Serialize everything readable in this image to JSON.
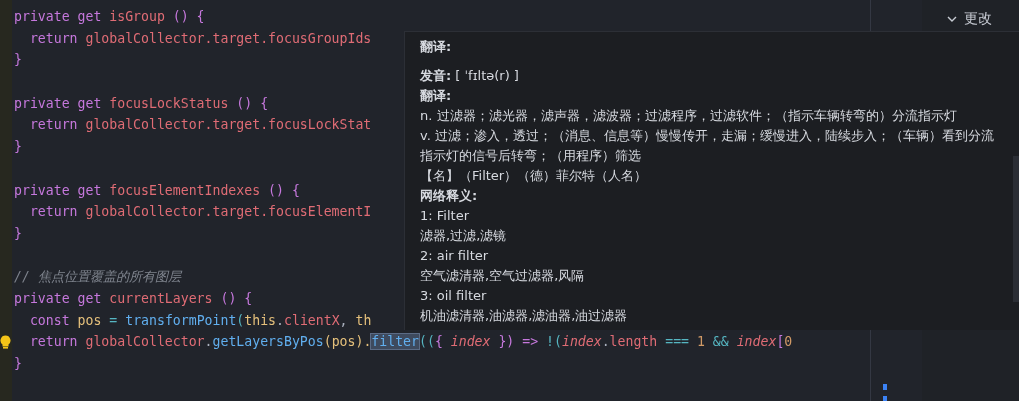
{
  "editor": {
    "lines": [
      {
        "kind": "code",
        "tokens": [
          {
            "text": "private get ",
            "kind": "keyword"
          },
          {
            "text": "isGroup",
            "kind": "property"
          },
          {
            "text": " () {",
            "kind": "keyword"
          }
        ]
      },
      {
        "kind": "code",
        "tokens": [
          {
            "text": "  return ",
            "kind": "keyword"
          },
          {
            "text": "globalCollector.target.focusGroupIds",
            "kind": "property"
          }
        ]
      },
      {
        "kind": "code",
        "tokens": [
          {
            "text": "}",
            "kind": "keyword"
          }
        ]
      },
      {
        "kind": "blank"
      },
      {
        "kind": "code",
        "tokens": [
          {
            "text": "private get ",
            "kind": "keyword"
          },
          {
            "text": "focusLockStatus",
            "kind": "property"
          },
          {
            "text": " () {",
            "kind": "keyword"
          }
        ]
      },
      {
        "kind": "code",
        "tokens": [
          {
            "text": "  return ",
            "kind": "keyword"
          },
          {
            "text": "globalCollector.target.focusLockStat",
            "kind": "property"
          }
        ]
      },
      {
        "kind": "code",
        "tokens": [
          {
            "text": "}",
            "kind": "keyword"
          }
        ]
      },
      {
        "kind": "blank"
      },
      {
        "kind": "code",
        "tokens": [
          {
            "text": "private get ",
            "kind": "keyword"
          },
          {
            "text": "focusElementIndexes",
            "kind": "property"
          },
          {
            "text": " () {",
            "kind": "keyword"
          }
        ]
      },
      {
        "kind": "code",
        "tokens": [
          {
            "text": "  return ",
            "kind": "keyword"
          },
          {
            "text": "globalCollector.target.focusElementI",
            "kind": "property"
          }
        ]
      },
      {
        "kind": "code",
        "tokens": [
          {
            "text": "}",
            "kind": "keyword"
          }
        ]
      },
      {
        "kind": "blank"
      },
      {
        "kind": "comment",
        "tokens": [
          {
            "text": "// 焦点位置覆盖的所有图层",
            "kind": "comment"
          }
        ]
      },
      {
        "kind": "code",
        "tokens": [
          {
            "text": "private get ",
            "kind": "keyword"
          },
          {
            "text": "currentLayers",
            "kind": "property"
          },
          {
            "text": " () {",
            "kind": "keyword"
          }
        ]
      },
      {
        "kind": "code",
        "tokens": [
          {
            "text": "  const ",
            "kind": "keyword"
          },
          {
            "text": "pos",
            "kind": "variable"
          },
          {
            "text": " = ",
            "kind": "operator"
          },
          {
            "text": "transformPoint",
            "kind": "function"
          },
          {
            "text": "(",
            "kind": "operator"
          },
          {
            "text": "this",
            "kind": "variable"
          },
          {
            "text": ".",
            "kind": "plain"
          },
          {
            "text": "clientX",
            "kind": "property"
          },
          {
            "text": ", ",
            "kind": "plain"
          },
          {
            "text": "th",
            "kind": "variable"
          }
        ]
      },
      {
        "kind": "code",
        "lightbulb": true,
        "tokens": [
          {
            "text": "  return ",
            "kind": "keyword"
          },
          {
            "text": "globalCollector",
            "kind": "property"
          },
          {
            "text": ".",
            "kind": "plain"
          },
          {
            "text": "getLayersByPos",
            "kind": "function"
          },
          {
            "text": "(",
            "kind": "variable"
          },
          {
            "text": "pos",
            "kind": "variable"
          },
          {
            "text": ").",
            "kind": "variable"
          },
          {
            "text": "filter",
            "kind": "match"
          },
          {
            "text": "((",
            "kind": "operator"
          },
          {
            "text": "{ ",
            "kind": "keyword"
          },
          {
            "text": "index",
            "kind": "param"
          },
          {
            "text": " })",
            "kind": "keyword"
          },
          {
            "text": " => ",
            "kind": "keyword"
          },
          {
            "text": "!(",
            "kind": "operator"
          },
          {
            "text": "index",
            "kind": "param"
          },
          {
            "text": ".",
            "kind": "plain"
          },
          {
            "text": "length",
            "kind": "property"
          },
          {
            "text": " === ",
            "kind": "operator"
          },
          {
            "text": "1",
            "kind": "number"
          },
          {
            "text": " && ",
            "kind": "operator"
          },
          {
            "text": "index",
            "kind": "param"
          },
          {
            "text": "[",
            "kind": "keyword"
          },
          {
            "text": "0",
            "kind": "number"
          }
        ]
      },
      {
        "kind": "code",
        "tokens": [
          {
            "text": "}",
            "kind": "keyword"
          }
        ]
      }
    ]
  },
  "side_panel": {
    "section": {
      "label": "更改",
      "expanded": true
    }
  },
  "translation_popup": {
    "title": "翻译:",
    "entries": [
      {
        "kind": "text",
        "text": "**发音:** [ ˈfɪltə(r) ]"
      },
      {
        "kind": "heading",
        "text": "翻译:"
      },
      {
        "kind": "text",
        "text": "n. 过滤器；滤光器，滤声器，滤波器；过滤程序，过滤软件；（指示车辆转弯的）分流指示灯"
      },
      {
        "kind": "text",
        "text": "v. 过滤；渗入，透过；（消息、信息等）慢慢传开，走漏；缓慢进入，陆续步入；（车辆）看到分流指示灯的信号后转弯；（用程序）筛选"
      },
      {
        "kind": "text",
        "text": "【名】（Filter）（德）菲尔特（人名）"
      },
      {
        "kind": "heading",
        "text": "网络释义:"
      },
      {
        "kind": "text",
        "text": "1: Filter"
      },
      {
        "kind": "text",
        "text": "滤器,过滤,滤镜"
      },
      {
        "kind": "text",
        "text": "2: air filter"
      },
      {
        "kind": "text",
        "text": "空气滤清器,空气过滤器,风隔"
      },
      {
        "kind": "text",
        "text": "3: oil filter"
      },
      {
        "kind": "text",
        "text": "机油滤清器,油滤器,滤油器,油过滤器"
      }
    ]
  }
}
